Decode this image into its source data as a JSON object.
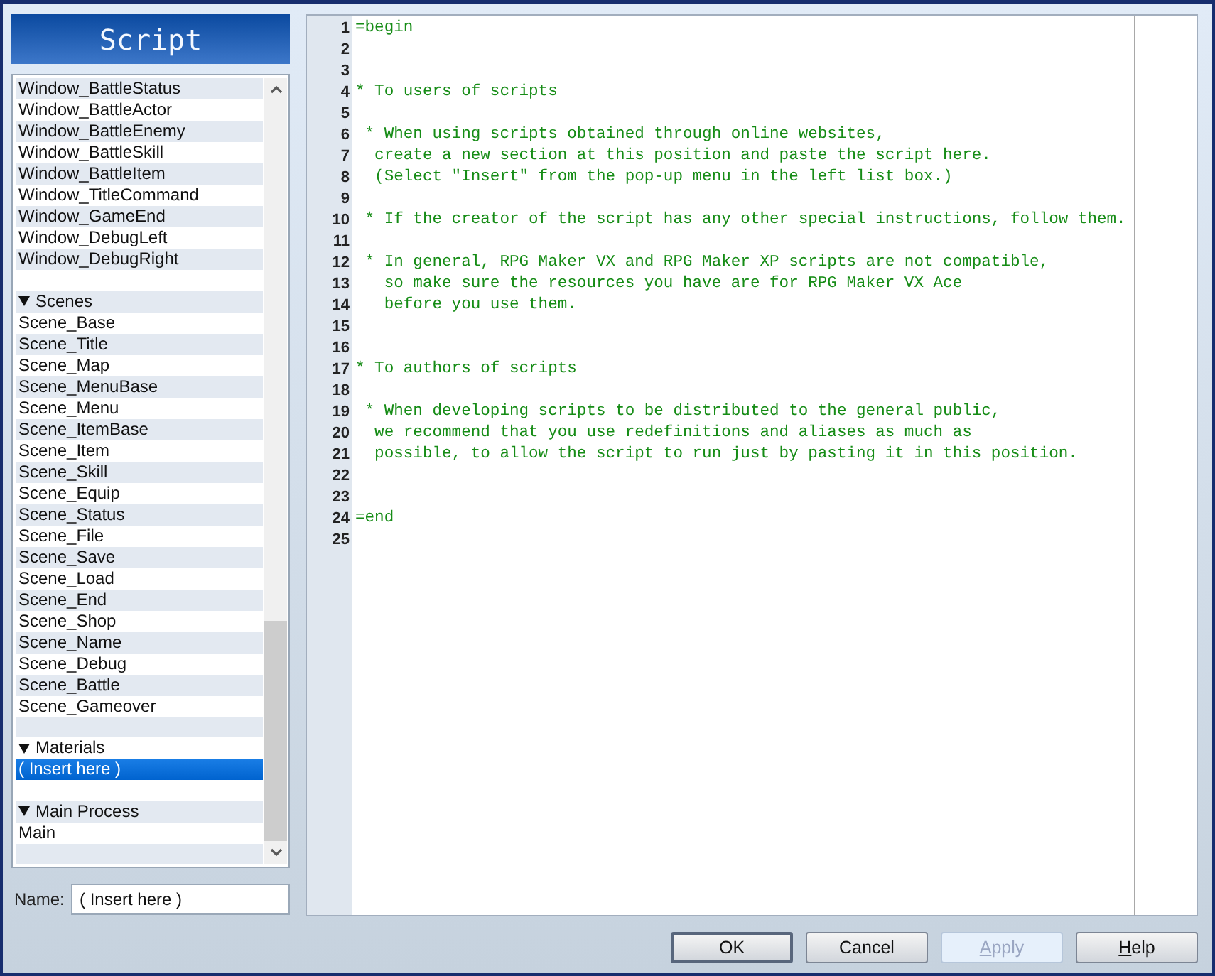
{
  "title": "Script",
  "list": {
    "rows": [
      {
        "kind": "item",
        "label": "Window_BattleStatus",
        "selected": false
      },
      {
        "kind": "item",
        "label": "Window_BattleActor",
        "selected": false
      },
      {
        "kind": "item",
        "label": "Window_BattleEnemy",
        "selected": false
      },
      {
        "kind": "item",
        "label": "Window_BattleSkill",
        "selected": false
      },
      {
        "kind": "item",
        "label": "Window_BattleItem",
        "selected": false
      },
      {
        "kind": "item",
        "label": "Window_TitleCommand",
        "selected": false
      },
      {
        "kind": "item",
        "label": "Window_GameEnd",
        "selected": false
      },
      {
        "kind": "item",
        "label": "Window_DebugLeft",
        "selected": false
      },
      {
        "kind": "item",
        "label": "Window_DebugRight",
        "selected": false
      },
      {
        "kind": "blank",
        "selected": false
      },
      {
        "kind": "folder",
        "label": "Scenes",
        "expanded": true,
        "selected": false
      },
      {
        "kind": "item",
        "label": "Scene_Base",
        "selected": false
      },
      {
        "kind": "item",
        "label": "Scene_Title",
        "selected": false
      },
      {
        "kind": "item",
        "label": "Scene_Map",
        "selected": false
      },
      {
        "kind": "item",
        "label": "Scene_MenuBase",
        "selected": false
      },
      {
        "kind": "item",
        "label": "Scene_Menu",
        "selected": false
      },
      {
        "kind": "item",
        "label": "Scene_ItemBase",
        "selected": false
      },
      {
        "kind": "item",
        "label": "Scene_Item",
        "selected": false
      },
      {
        "kind": "item",
        "label": "Scene_Skill",
        "selected": false
      },
      {
        "kind": "item",
        "label": "Scene_Equip",
        "selected": false
      },
      {
        "kind": "item",
        "label": "Scene_Status",
        "selected": false
      },
      {
        "kind": "item",
        "label": "Scene_File",
        "selected": false
      },
      {
        "kind": "item",
        "label": "Scene_Save",
        "selected": false
      },
      {
        "kind": "item",
        "label": "Scene_Load",
        "selected": false
      },
      {
        "kind": "item",
        "label": "Scene_End",
        "selected": false
      },
      {
        "kind": "item",
        "label": "Scene_Shop",
        "selected": false
      },
      {
        "kind": "item",
        "label": "Scene_Name",
        "selected": false
      },
      {
        "kind": "item",
        "label": "Scene_Debug",
        "selected": false
      },
      {
        "kind": "item",
        "label": "Scene_Battle",
        "selected": false
      },
      {
        "kind": "item",
        "label": "Scene_Gameover",
        "selected": false
      },
      {
        "kind": "blank",
        "selected": false
      },
      {
        "kind": "folder",
        "label": "Materials",
        "expanded": true,
        "selected": false
      },
      {
        "kind": "item",
        "label": "( Insert here )",
        "selected": true
      },
      {
        "kind": "blank",
        "selected": false
      },
      {
        "kind": "folder",
        "label": "Main Process",
        "expanded": true,
        "selected": false
      },
      {
        "kind": "item",
        "label": "Main",
        "selected": false
      },
      {
        "kind": "blank",
        "selected": false
      }
    ]
  },
  "name_field": {
    "label": "Name:",
    "value": "( Insert here )"
  },
  "editor": {
    "lines": [
      {
        "number": "1",
        "text": "=begin"
      },
      {
        "number": "2"
      },
      {
        "number": "3"
      },
      {
        "number": "4",
        "text": "* To users of scripts"
      },
      {
        "number": "5"
      },
      {
        "number": "6",
        "text": " * When using scripts obtained through online websites,"
      },
      {
        "number": "7",
        "text": "  create a new section at this position and paste the script here."
      },
      {
        "number": "8",
        "text": "  (Select \"Insert\" from the pop-up menu in the left list box.)"
      },
      {
        "number": "9"
      },
      {
        "number": "10",
        "text": " * If the creator of the script has any other special instructions, follow them."
      },
      {
        "number": "11"
      },
      {
        "number": "12",
        "text": " * In general, RPG Maker VX and RPG Maker XP scripts are not compatible,"
      },
      {
        "number": "13",
        "text": "   so make sure the resources you have are for RPG Maker VX Ace"
      },
      {
        "number": "14",
        "text": "   before you use them."
      },
      {
        "number": "15"
      },
      {
        "number": "16"
      },
      {
        "number": "17",
        "text": "* To authors of scripts"
      },
      {
        "number": "18"
      },
      {
        "number": "19",
        "text": " * When developing scripts to be distributed to the general public,"
      },
      {
        "number": "20",
        "text": "  we recommend that you use redefinitions and aliases as much as"
      },
      {
        "number": "21",
        "text": "  possible, to allow the script to run just by pasting it in this position."
      },
      {
        "number": "22"
      },
      {
        "number": "23"
      },
      {
        "number": "24",
        "text": "=end"
      },
      {
        "number": "25"
      }
    ]
  },
  "buttons": [
    {
      "label": "OK",
      "default": true,
      "disabled": false,
      "access_key_underlined": false
    },
    {
      "label": "Cancel",
      "default": false,
      "disabled": false,
      "access_key_underlined": false
    },
    {
      "label": "Apply",
      "default": false,
      "disabled": true,
      "access_key_underlined": true
    },
    {
      "label": "Help",
      "default": false,
      "disabled": false,
      "access_key_underlined": true
    }
  ]
}
